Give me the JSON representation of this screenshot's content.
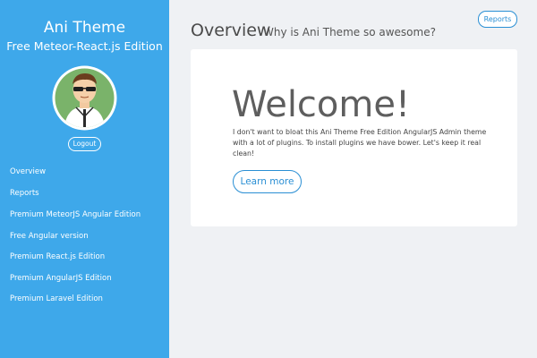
{
  "sidebar": {
    "brand_title": "Ani Theme",
    "brand_subtitle": "Free Meteor-React.js Edition",
    "logout_label": "Logout",
    "items": [
      {
        "label": "Overview"
      },
      {
        "label": "Reports"
      },
      {
        "label": "Premium MeteorJS Angular Edition"
      },
      {
        "label": "Free Angular version"
      },
      {
        "label": "Premium React.js Edition"
      },
      {
        "label": "Premium AngularJS Edition"
      },
      {
        "label": "Premium Laravel Edition"
      }
    ]
  },
  "header": {
    "title": "Overview",
    "subtitle": "Why is Ani Theme so awesome?",
    "reports_label": "Reports"
  },
  "card": {
    "heading": "Welcome!",
    "text": "I don't want to bloat this Ani Theme Free Edition AngularJS Admin theme with a lot of plugins. To install plugins we have bower. Let's keep it real clean!",
    "button_label": "Learn more"
  },
  "colors": {
    "sidebar_bg": "#3ea8ea",
    "accent": "#2a8fd4",
    "page_bg": "#eff1f4"
  }
}
